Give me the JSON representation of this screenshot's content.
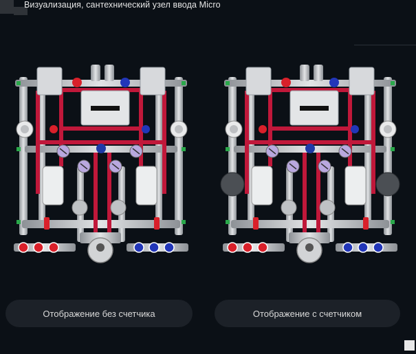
{
  "window": {
    "title": "Визуализация, сантехнический узел ввода Micro"
  },
  "buttons": {
    "without_meter": "Отображение без счетчика",
    "with_meter": "Отображение с счетчиком"
  },
  "icons": {
    "app": "app-icon",
    "pump": "pump-logo-icon"
  },
  "colors": {
    "background": "#0b1016",
    "pipe_red": "#c0183a",
    "pipe_gray": "#bfc3c7",
    "valve_red": "#d9202a",
    "valve_blue": "#2236b8",
    "button_bg": "#1c2128"
  },
  "diagrams": [
    {
      "variant": "without-meter"
    },
    {
      "variant": "with-meter"
    }
  ]
}
